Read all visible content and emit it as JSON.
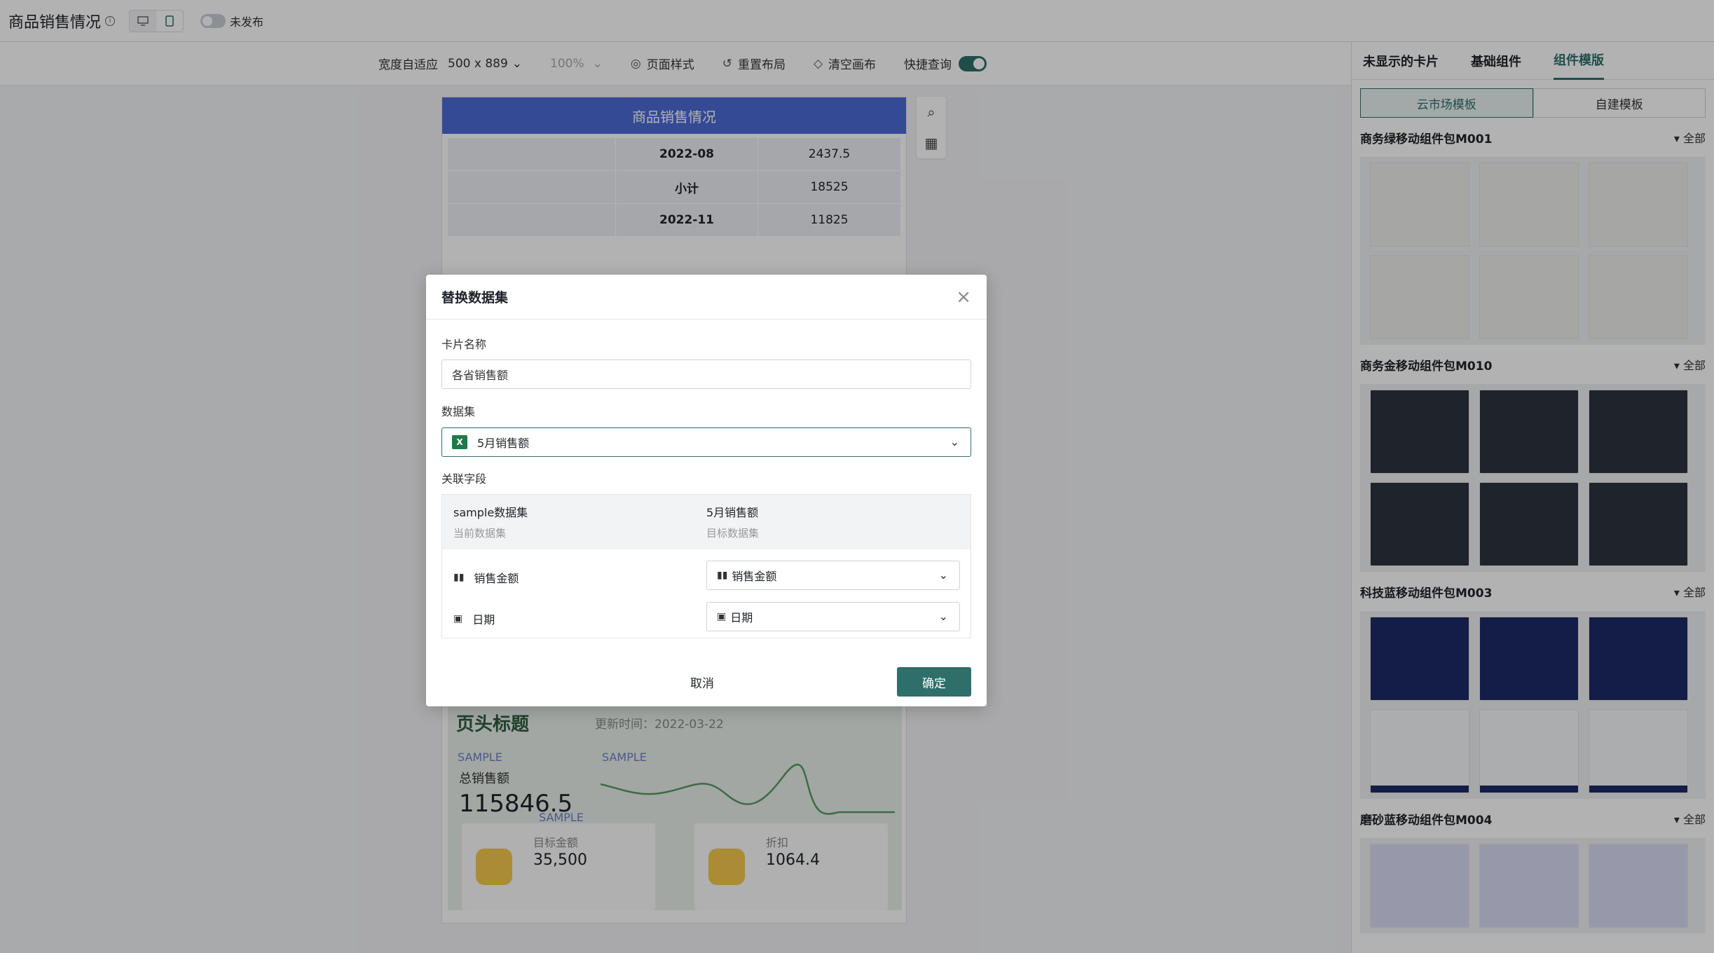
{
  "header": {
    "title": "商品销售情况",
    "publish_status": "未发布"
  },
  "toolbar": {
    "size_mode": "宽度自适应",
    "size_value": "500 x 889",
    "zoom": "100%",
    "page_style": "页面样式",
    "reset_layout": "重置布局",
    "clear_canvas": "清空画布",
    "quick_query": "快捷查询"
  },
  "canvas": {
    "card_title": "商品销售情况",
    "table_rows": [
      {
        "month": "2022-08",
        "value": "2437.5"
      },
      {
        "month": "小计",
        "value": "18525"
      },
      {
        "month": "2022-11",
        "value": "11825"
      }
    ],
    "section_title": "页头标题",
    "update_time": "更新时间：2022-03-22",
    "sample_label": "SAMPLE",
    "kpi_label": "总销售额",
    "kpi_value": "115846.5",
    "mini_cards": [
      {
        "label": "目标金额",
        "value": "35,500"
      },
      {
        "label": "折扣",
        "value": "1064.4"
      }
    ]
  },
  "right_panel": {
    "tabs": [
      "未显示的卡片",
      "基础组件",
      "组件模版"
    ],
    "subtabs": [
      "云市场模板",
      "自建模板"
    ],
    "all_label": "全部",
    "packs": [
      "商务绿移动组件包M001",
      "商务金移动组件包M010",
      "科技蓝移动组件包M003",
      "磨砂蓝移动组件包M004"
    ]
  },
  "modal": {
    "title": "替换数据集",
    "card_name_label": "卡片名称",
    "card_name_value": "各省销售额",
    "dataset_label": "数据集",
    "dataset_value": "5月销售额",
    "relation_label": "关联字段",
    "source_dataset": "sample数据集",
    "source_sub": "当前数据集",
    "target_dataset": "5月销售额",
    "target_sub": "目标数据集",
    "fields": [
      {
        "source": "销售金额",
        "target": "销售金额",
        "icon": "bar-chart-icon"
      },
      {
        "source": "日期",
        "target": "日期",
        "icon": "calendar-icon"
      }
    ],
    "cancel": "取消",
    "confirm": "确定"
  }
}
